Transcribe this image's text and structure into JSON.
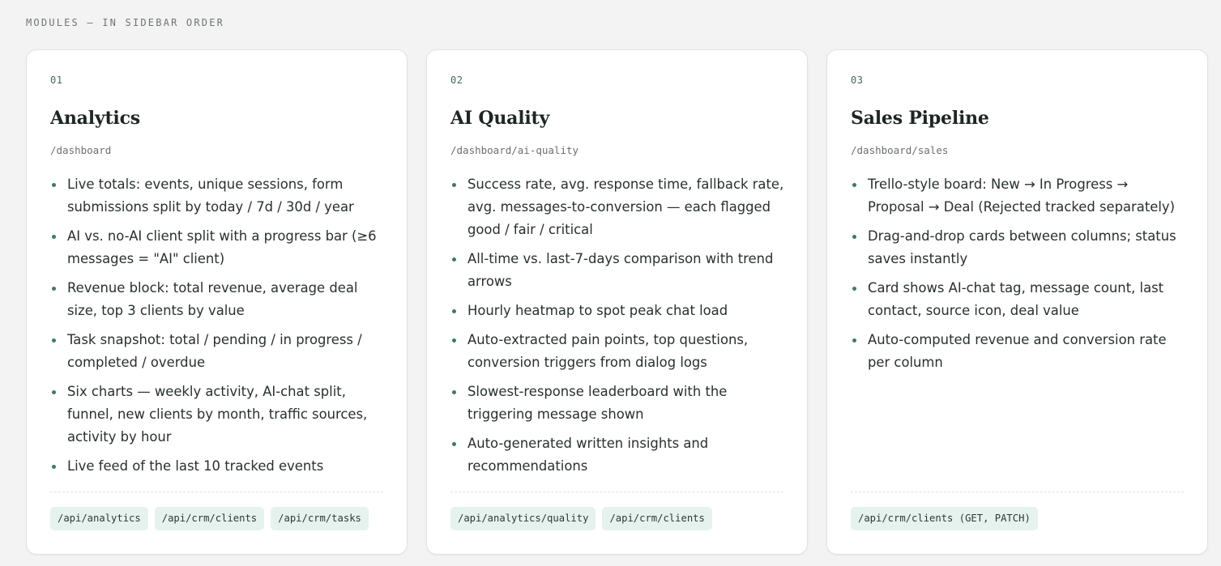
{
  "section": {
    "label": "MODULES — IN SIDEBAR ORDER"
  },
  "cards": [
    {
      "num": "01",
      "title": "Analytics",
      "route": "/dashboard",
      "features": [
        "Live totals: events, unique sessions, form submissions split by today / 7d / 30d / year",
        "AI vs. no-AI client split with a progress bar (≥6 messages = \"AI\" client)",
        "Revenue block: total revenue, average deal size, top 3 clients by value",
        "Task snapshot: total / pending / in progress / completed / overdue",
        "Six charts — weekly activity, AI-chat split, funnel, new clients by month, traffic sources, activity by hour",
        "Live feed of the last 10 tracked events"
      ],
      "tags": [
        "/api/analytics",
        "/api/crm/clients",
        "/api/crm/tasks"
      ]
    },
    {
      "num": "02",
      "title": "AI Quality",
      "route": "/dashboard/ai-quality",
      "features": [
        "Success rate, avg. response time, fallback rate, avg. messages-to-conversion — each flagged good / fair / critical",
        "All-time vs. last-7-days comparison with trend arrows",
        "Hourly heatmap to spot peak chat load",
        "Auto-extracted pain points, top questions, conversion triggers from dialog logs",
        "Slowest-response leaderboard with the triggering message shown",
        "Auto-generated written insights and recommendations"
      ],
      "tags": [
        "/api/analytics/quality",
        "/api/crm/clients"
      ]
    },
    {
      "num": "03",
      "title": "Sales Pipeline",
      "route": "/dashboard/sales",
      "features": [
        "Trello-style board: New → In Progress → Proposal → Deal (Rejected tracked separately)",
        "Drag-and-drop cards between columns; status saves instantly",
        "Card shows AI-chat tag, message count, last contact, source icon, deal value",
        "Auto-computed revenue and conversion rate per column"
      ],
      "tags": [
        "/api/crm/clients (GET, PATCH)"
      ]
    }
  ]
}
